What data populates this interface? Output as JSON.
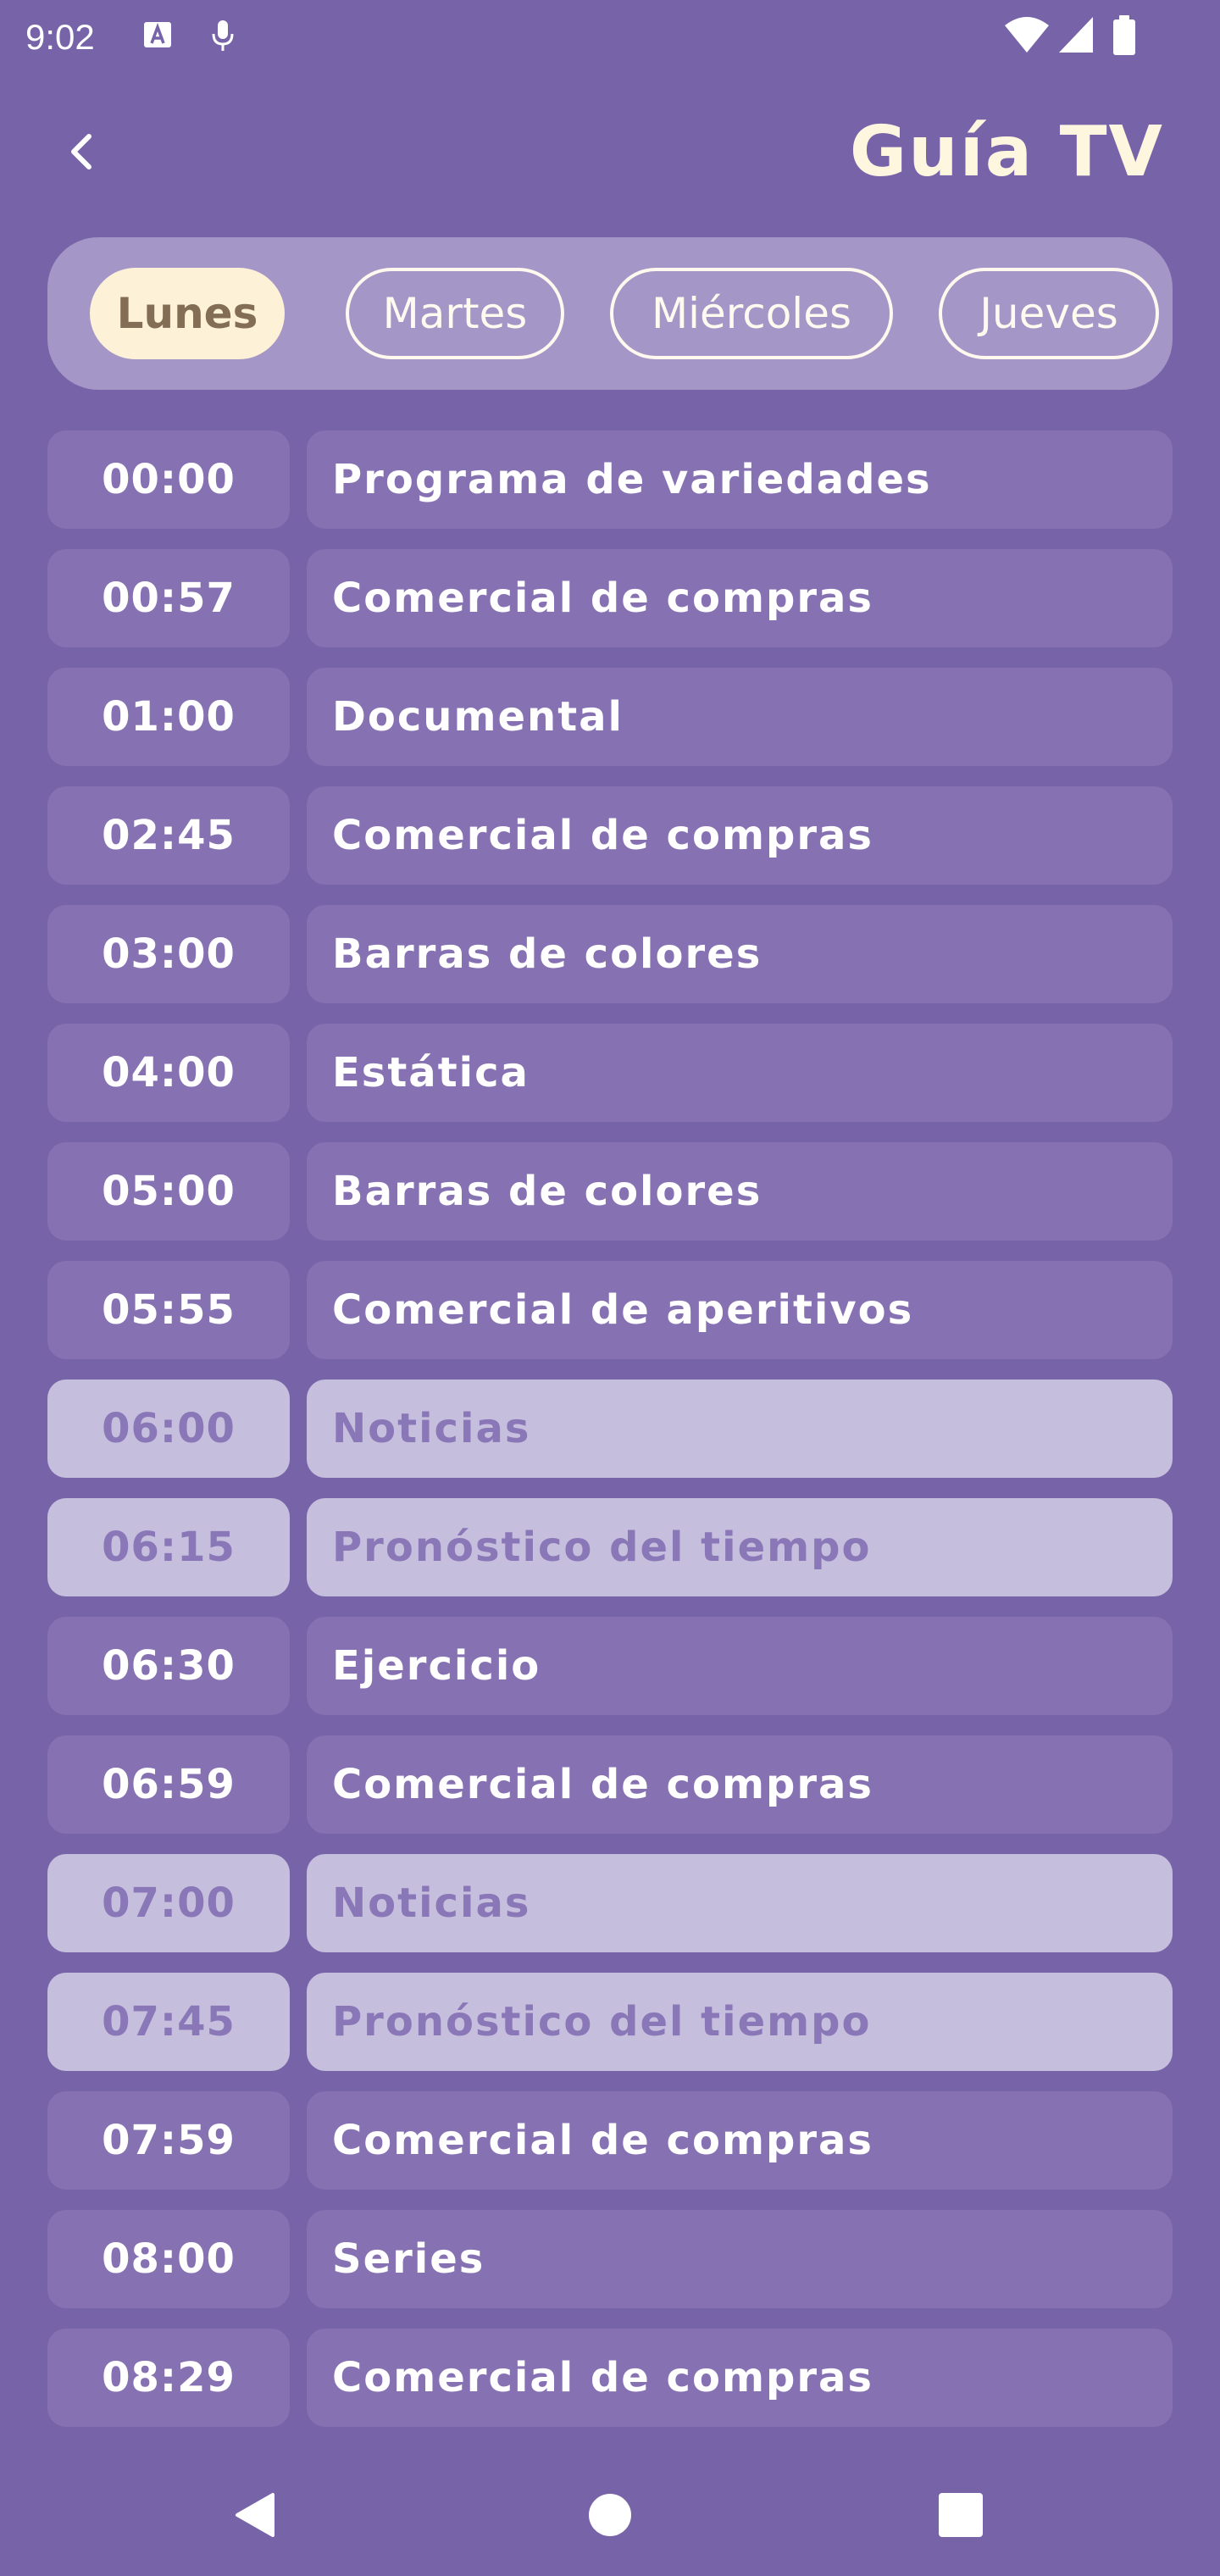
{
  "status_bar": {
    "time": "9:02",
    "icons": [
      "text-a-icon",
      "mic-icon",
      "wifi-icon",
      "signal-icon",
      "battery-icon"
    ]
  },
  "header": {
    "back_icon": "chevron-left-icon",
    "title": "Guía TV"
  },
  "day_tabs": [
    {
      "label": "Lunes",
      "selected": true
    },
    {
      "label": "Martes",
      "selected": false
    },
    {
      "label": "Miércoles",
      "selected": false
    },
    {
      "label": "Jueves",
      "selected": false
    }
  ],
  "schedule": [
    {
      "time": "00:00",
      "program": "Programa de variedades",
      "highlighted": false
    },
    {
      "time": "00:57",
      "program": "Comercial de compras",
      "highlighted": false
    },
    {
      "time": "01:00",
      "program": "Documental",
      "highlighted": false
    },
    {
      "time": "02:45",
      "program": "Comercial de compras",
      "highlighted": false
    },
    {
      "time": "03:00",
      "program": "Barras de colores",
      "highlighted": false
    },
    {
      "time": "04:00",
      "program": "Estática",
      "highlighted": false
    },
    {
      "time": "05:00",
      "program": "Barras de colores",
      "highlighted": false
    },
    {
      "time": "05:55",
      "program": "Comercial de aperitivos",
      "highlighted": false
    },
    {
      "time": "06:00",
      "program": "Noticias",
      "highlighted": true
    },
    {
      "time": "06:15",
      "program": "Pronóstico del tiempo",
      "highlighted": true
    },
    {
      "time": "06:30",
      "program": "Ejercicio",
      "highlighted": false
    },
    {
      "time": "06:59",
      "program": "Comercial de compras",
      "highlighted": false
    },
    {
      "time": "07:00",
      "program": "Noticias",
      "highlighted": true
    },
    {
      "time": "07:45",
      "program": "Pronóstico del tiempo",
      "highlighted": true
    },
    {
      "time": "07:59",
      "program": "Comercial de compras",
      "highlighted": false
    },
    {
      "time": "08:00",
      "program": "Series",
      "highlighted": false
    },
    {
      "time": "08:29",
      "program": "Comercial de compras",
      "highlighted": false
    }
  ],
  "nav_bar": {
    "icons": [
      "back-triangle-icon",
      "home-circle-icon",
      "recents-square-icon"
    ]
  },
  "colors": {
    "background": "#7663a8",
    "cell": "#8672b2",
    "highlight_cell": "#c5bedd",
    "highlight_text": "#8a77b7",
    "title": "#fff6e0",
    "tab_selected_bg": "#fdf1d8",
    "tab_selected_text": "#836d55"
  }
}
